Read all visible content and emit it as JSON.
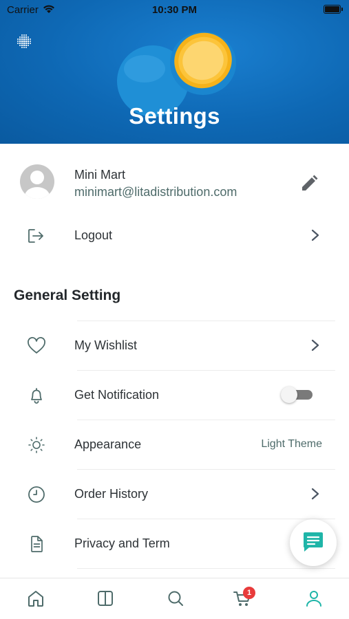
{
  "status_bar": {
    "carrier": "Carrier",
    "time": "10:30 PM"
  },
  "header": {
    "title": "Settings"
  },
  "profile": {
    "name": "Mini Mart",
    "email": "minimart@litadistribution.com"
  },
  "logout": {
    "label": "Logout"
  },
  "general": {
    "title": "General Setting",
    "items": [
      {
        "label": "My Wishlist",
        "icon": "heart-icon"
      },
      {
        "label": "Get Notification",
        "icon": "bell-icon",
        "toggle_on": false
      },
      {
        "label": "Appearance",
        "icon": "sun-icon",
        "value": "Light Theme"
      },
      {
        "label": "Order History",
        "icon": "clock-icon"
      },
      {
        "label": "Privacy and Term",
        "icon": "document-icon"
      }
    ]
  },
  "cart": {
    "badge": "1"
  },
  "colors": {
    "accent": "#1fb5a8",
    "header_blue": "#0e68b4",
    "badge": "#e83b3b"
  }
}
